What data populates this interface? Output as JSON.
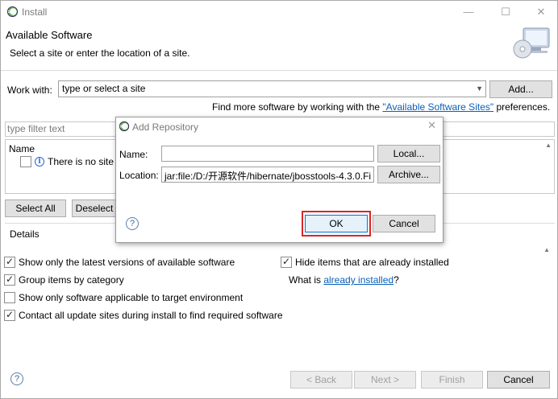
{
  "window": {
    "title": "Install",
    "controls": {
      "minimize": "—",
      "maximize": "☐",
      "close": "✕"
    }
  },
  "header": {
    "title": "Available Software",
    "description": "Select a site or enter the location of a site."
  },
  "work_with": {
    "label": "Work with:",
    "value": "type or select a site",
    "add_button": "Add..."
  },
  "find_more": {
    "prefix": "Find more software by working with the ",
    "link": "\"Available Software Sites\"",
    "suffix": " preferences."
  },
  "filter": {
    "placeholder": "type filter text"
  },
  "tree": {
    "column": "Name",
    "empty_message": "There is no site s"
  },
  "selection_buttons": {
    "select_all": "Select All",
    "deselect_all": "Deselect"
  },
  "details": {
    "label": "Details"
  },
  "options": [
    {
      "label": "Show only the latest versions of available software",
      "checked": true
    },
    {
      "label": "Group items by category",
      "checked": true
    },
    {
      "label": "Show only software applicable to target environment",
      "checked": false
    },
    {
      "label": "Contact all update sites during install to find required software",
      "checked": true
    },
    {
      "label": "Hide items that are already installed",
      "checked": true
    }
  ],
  "what_is": {
    "prefix": "What is ",
    "link": "already installed",
    "suffix": "?"
  },
  "footer": {
    "back": "< Back",
    "next": "Next >",
    "finish": "Finish",
    "cancel": "Cancel",
    "help": "?"
  },
  "dialog": {
    "title": "Add Repository",
    "close": "✕",
    "name_label": "Name:",
    "name_value": "",
    "local_button": "Local...",
    "location_label": "Location:",
    "location_value": "jar:file:/D:/开源软件/hibernate/jbosstools-4.3.0.Fi",
    "archive_button": "Archive...",
    "help": "?",
    "ok": "OK",
    "cancel": "Cancel"
  },
  "colors": {
    "link": "#0b5fb8",
    "highlight": "#d8262a",
    "ok_border": "#0078d7"
  }
}
